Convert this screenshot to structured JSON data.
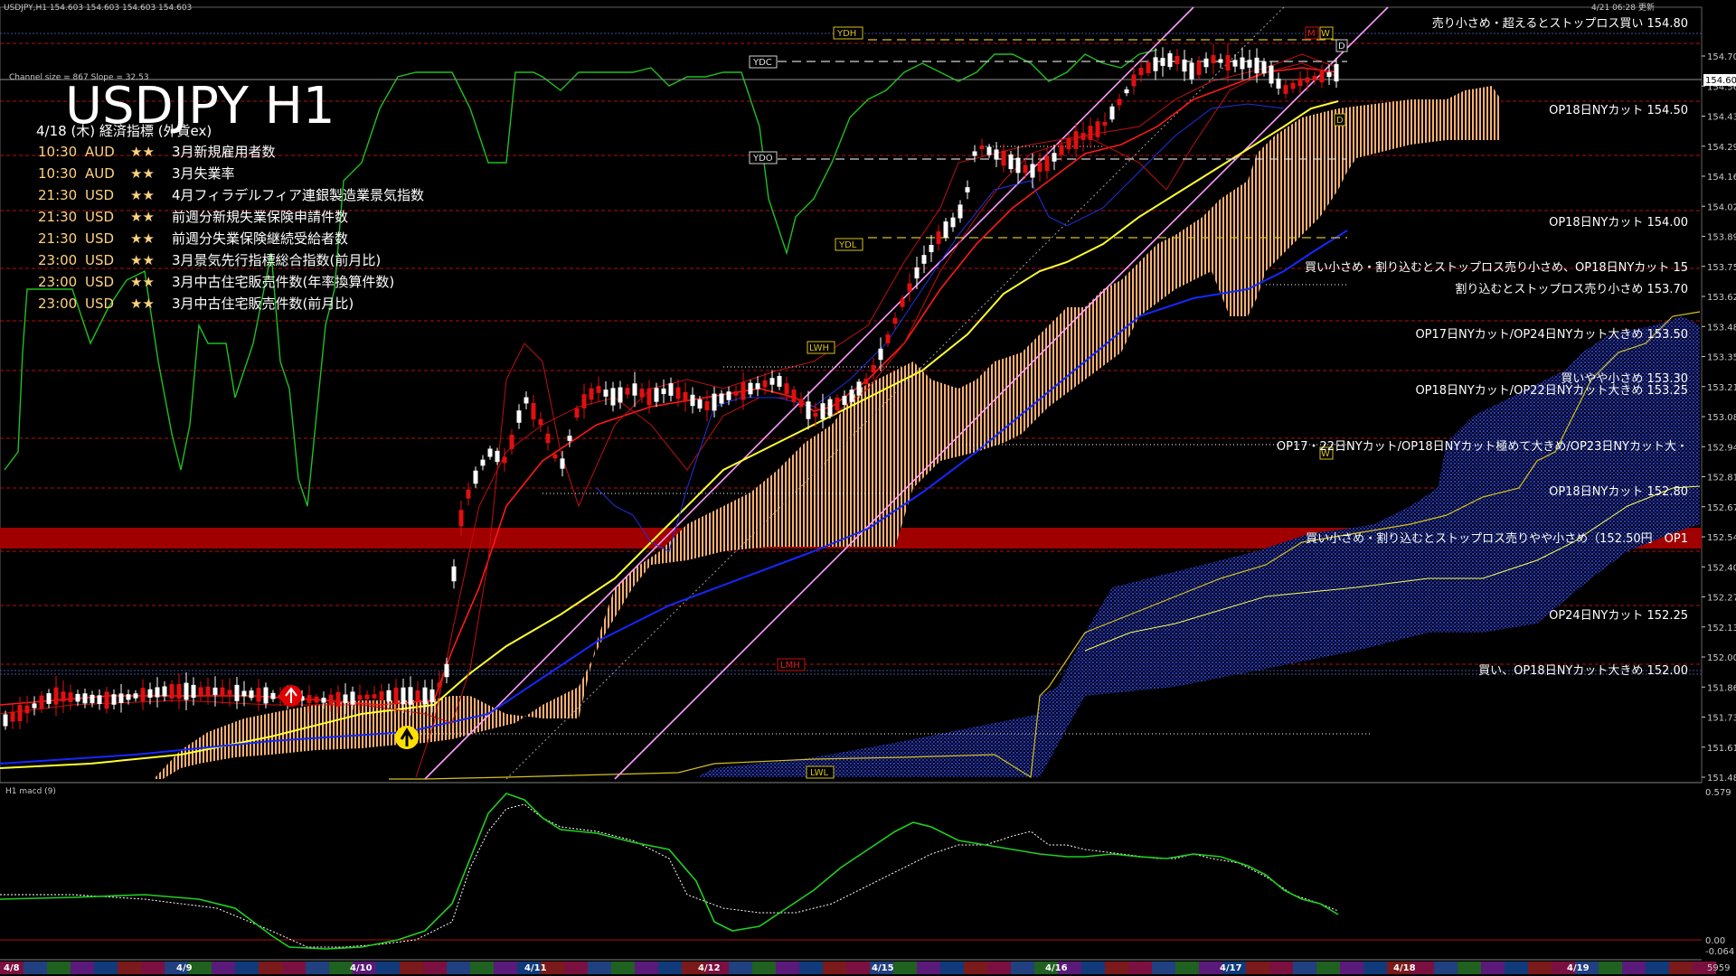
{
  "window": {
    "header_text": "USDJPY,H1  154.603 154.603 154.603 154.603",
    "channel_info": "Channel size = 867 Slope = 32.53",
    "symbol_title": "USDJPY H1",
    "clock_text": "4/21 06:28 更新"
  },
  "calendar": {
    "heading": "4/18 (木) 経済指標 (外貨ex)",
    "events": [
      {
        "time": "10:30",
        "currency": "AUD",
        "stars": "★★",
        "name": "3月新規雇用者数"
      },
      {
        "time": "10:30",
        "currency": "AUD",
        "stars": "★★",
        "name": "3月失業率"
      },
      {
        "time": "21:30",
        "currency": "USD",
        "stars": "★★",
        "name": "4月フィラデルフィア連銀製造業景気指数"
      },
      {
        "time": "21:30",
        "currency": "USD",
        "stars": "★★",
        "name": "前週分新規失業保険申請件数"
      },
      {
        "time": "21:30",
        "currency": "USD",
        "stars": "★★",
        "name": "前週分失業保険継続受給者数"
      },
      {
        "time": "23:00",
        "currency": "USD",
        "stars": "★★",
        "name": "3月景気先行指標総合指数(前月比)"
      },
      {
        "time": "23:00",
        "currency": "USD",
        "stars": "★★",
        "name": "3月中古住宅販売件数(年率換算件数)"
      },
      {
        "time": "23:00",
        "currency": "USD",
        "stars": "★★",
        "name": "3月中古住宅販売件数(前月比)"
      }
    ]
  },
  "annotations": [
    {
      "text": "売り小さめ・超えるとストップロス買い 154.80"
    },
    {
      "text": "OP18日NYカット 154.50"
    },
    {
      "text": "OP18日NYカット 154.00"
    },
    {
      "text": "買い小さめ・割り込むとストップロス売り小さめ、OP18日NYカット 15"
    },
    {
      "text": "割り込むとストップロス売り小さめ 153.70"
    },
    {
      "text": "OP17日NYカット/OP24日NYカット大きめ 153.50"
    },
    {
      "text": "買いやや小さめ 153.30"
    },
    {
      "text": "OP18日NYカット/OP22日NYカット大きめ 153.25"
    },
    {
      "text": "OP17・22日NYカット/OP18日NYカット極めて大きめ/OP23日NYカット大・"
    },
    {
      "text": "OP18日NYカット 152.80"
    },
    {
      "text": "買い小さめ・割り込むとストップロス売りやや小さめ（152.50円　OP1"
    },
    {
      "text": "OP24日NYカット 152.25"
    },
    {
      "text": "買い、OP18日NYカット大きめ 152.00"
    }
  ],
  "level_tags": {
    "ydh": "YDH",
    "ydc": "YDC",
    "ydo": "YDO",
    "ydl": "YDL",
    "lwh": "LWH",
    "lmh": "LMH",
    "lwl": "LWL",
    "m": "M",
    "w": "W",
    "d": "D",
    "d2": "D",
    "w2": "W"
  },
  "price_axis": {
    "labels": [
      "154.700",
      "154.565",
      "154.430",
      "154.295",
      "154.160",
      "154.025",
      "153.890",
      "153.755",
      "153.620",
      "153.485",
      "153.350",
      "153.215",
      "153.080",
      "152.945",
      "152.810",
      "152.675",
      "152.540",
      "152.405",
      "152.270",
      "152.135",
      "152.000",
      "151.865",
      "151.730",
      "151.615",
      "151.480"
    ],
    "current_price": "154.603"
  },
  "date_axis": {
    "labels": [
      "4/8",
      "4/9",
      "4/10",
      "4/11",
      "4/12",
      "4/15",
      "4/16",
      "4/17",
      "4/18",
      "4/19"
    ]
  },
  "macd": {
    "label": "H1  macd (9)",
    "top_value": "0.579",
    "zero_value": "0.00",
    "bottom_value": "-0.064",
    "corner_value": "5959"
  },
  "colors": {
    "bull_candle": "#ffffff",
    "bear_candle": "#e01010",
    "kumo_up": "#ffb070",
    "kumo_down": "#2a3cc0",
    "ma_yellow": "#ffff30",
    "ma_blue": "#1428ff",
    "ma_red": "#ff1818",
    "channel": "#ff9cff",
    "macd_main": "#20d020",
    "macd_signal": "#ffffff",
    "sell_zone": "#a00000"
  }
}
